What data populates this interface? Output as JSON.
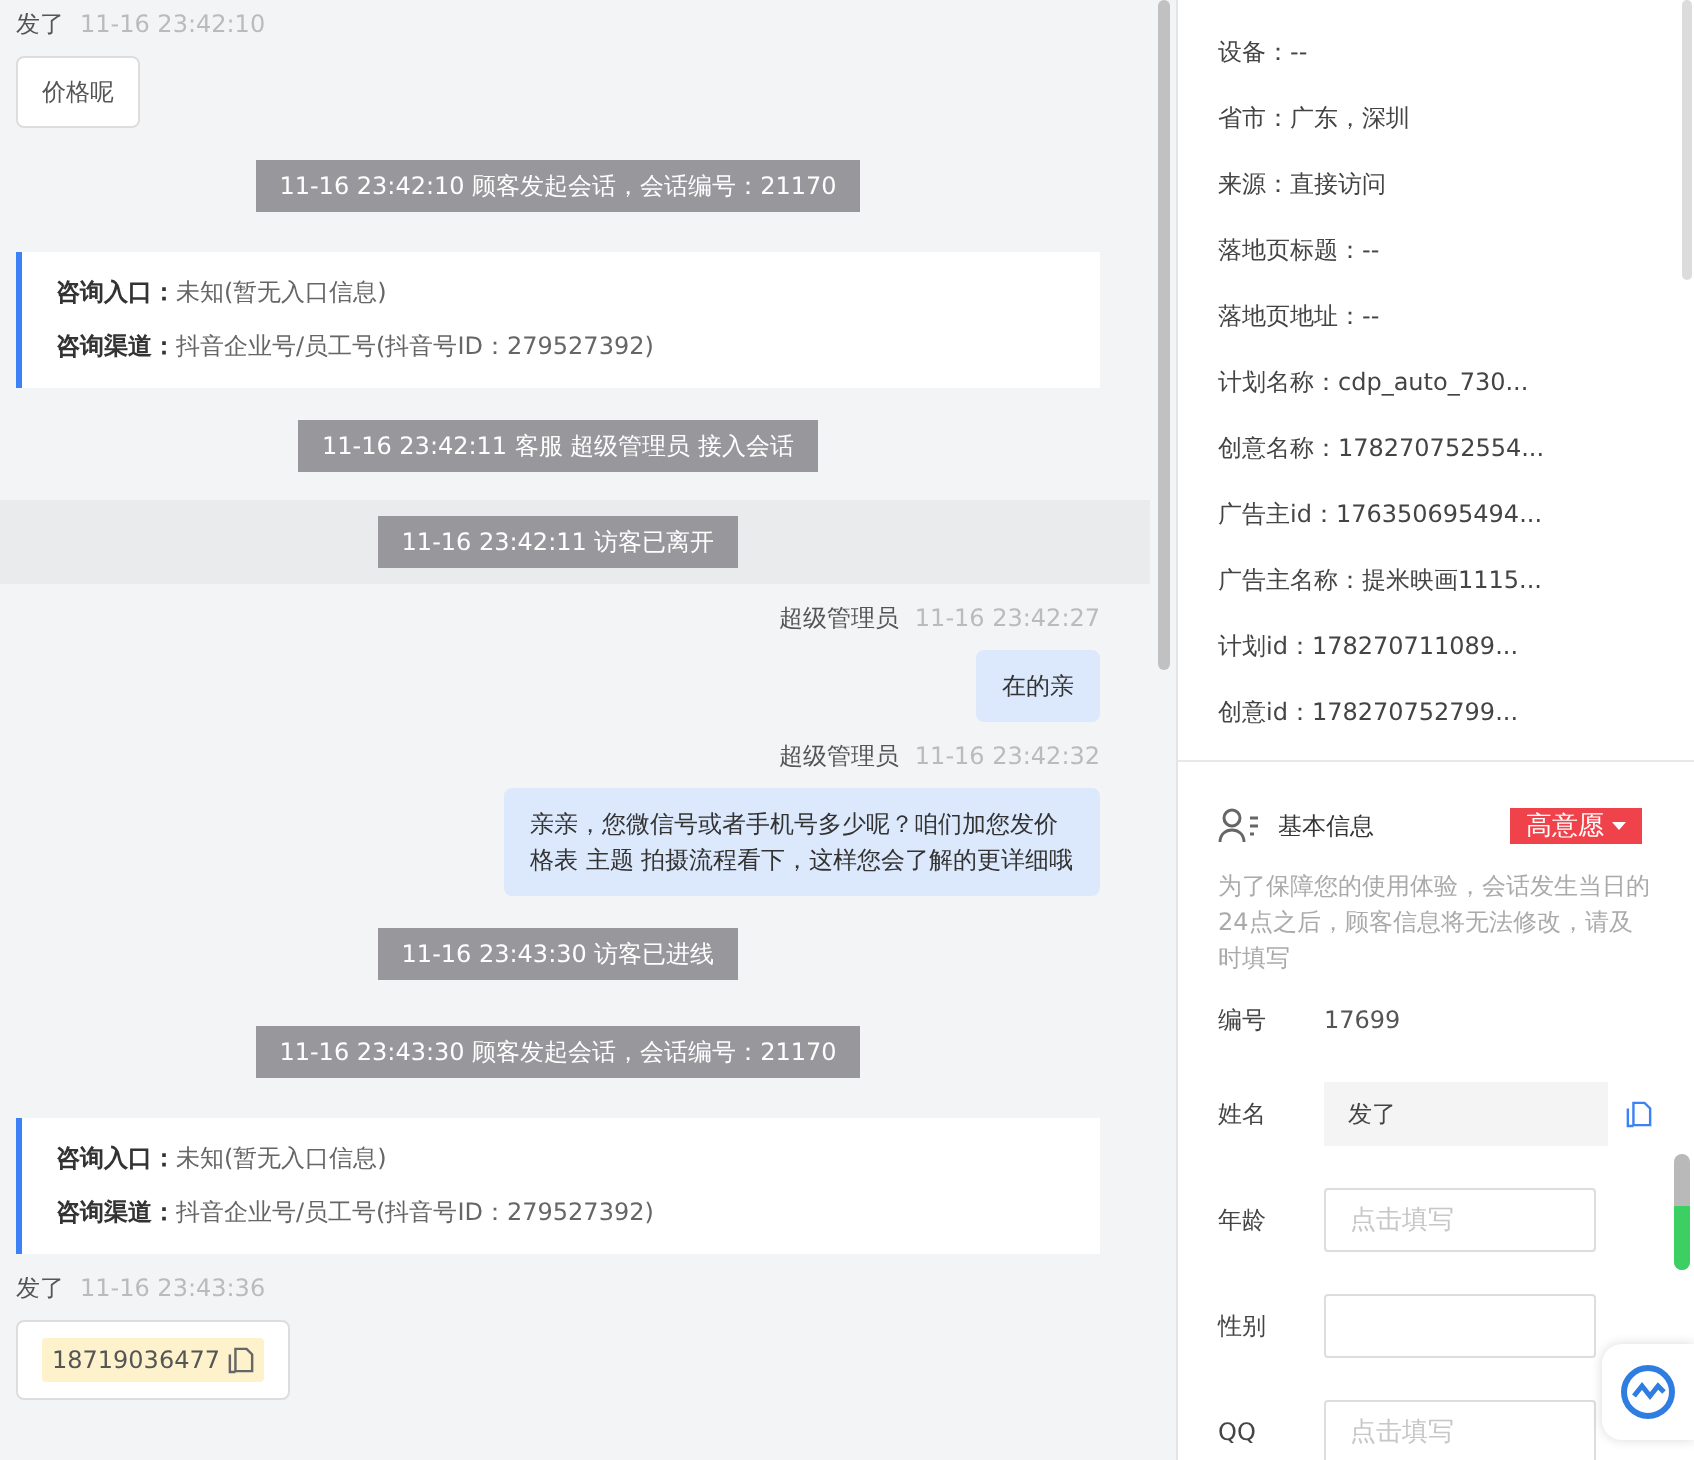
{
  "chat": {
    "items": [
      {
        "kind": "message",
        "outgoing": false,
        "sender": "发了",
        "time": "11-16 23:42:10",
        "text": "价格呢"
      },
      {
        "kind": "system",
        "text": "11-16 23:42:10 顾客发起会话，会话编号：21170",
        "highlighted": false
      },
      {
        "kind": "info",
        "rows": [
          {
            "label": "咨询入口：",
            "value": "未知(暂无入口信息)"
          },
          {
            "label": "咨询渠道：",
            "value": "抖音企业号/员工号(抖音号ID：279527392)"
          }
        ]
      },
      {
        "kind": "system",
        "text": "11-16 23:42:11 客服 超级管理员 接入会话",
        "highlighted": false
      },
      {
        "kind": "system",
        "text": "11-16 23:42:11 访客已离开",
        "highlighted": true
      },
      {
        "kind": "message",
        "outgoing": true,
        "sender": "超级管理员",
        "time": "11-16 23:42:27",
        "text": "在的亲"
      },
      {
        "kind": "message",
        "outgoing": true,
        "sender": "超级管理员",
        "time": "11-16 23:42:32",
        "text": "亲亲，您微信号或者手机号多少呢？咱们加您发价格表 主题 拍摄流程看下，这样您会了解的更详细哦"
      },
      {
        "kind": "system",
        "text": "11-16 23:43:30 访客已进线",
        "highlighted": false
      },
      {
        "kind": "system",
        "text": "11-16 23:43:30 顾客发起会话，会话编号：21170",
        "highlighted": false
      },
      {
        "kind": "info",
        "rows": [
          {
            "label": "咨询入口：",
            "value": "未知(暂无入口信息)"
          },
          {
            "label": "咨询渠道：",
            "value": "抖音企业号/员工号(抖音号ID：279527392)"
          }
        ]
      },
      {
        "kind": "phone",
        "outgoing": false,
        "sender": "发了",
        "time": "11-16 23:43:36",
        "text": "18719036477"
      }
    ]
  },
  "visitor_fields": [
    "设备：--",
    "省市：广东，深圳",
    "来源：直接访问",
    "落地页标题：--",
    "落地页地址：--",
    "计划名称：cdp_auto_730...",
    "创意名称：178270752554...",
    "广告主id：176350695494...",
    "广告主名称：提米映画1115...",
    "计划id：178270711089...",
    "创意id：178270752799..."
  ],
  "basic_info": {
    "title": "基本信息",
    "intent": "高意愿",
    "note": "为了保障您的使用体验，会话发生当日的24点之后，顾客信息将无法修改，请及时填写",
    "fields": [
      {
        "kind": "text",
        "label": "编号",
        "value": "17699"
      },
      {
        "kind": "readonly",
        "label": "姓名",
        "value": "发了"
      },
      {
        "kind": "input",
        "label": "年龄",
        "placeholder": "点击填写"
      },
      {
        "kind": "input",
        "label": "性别"
      },
      {
        "kind": "input",
        "label": "QQ",
        "placeholder": "点击填写"
      }
    ]
  },
  "side_meter": {
    "level": 0.55
  }
}
